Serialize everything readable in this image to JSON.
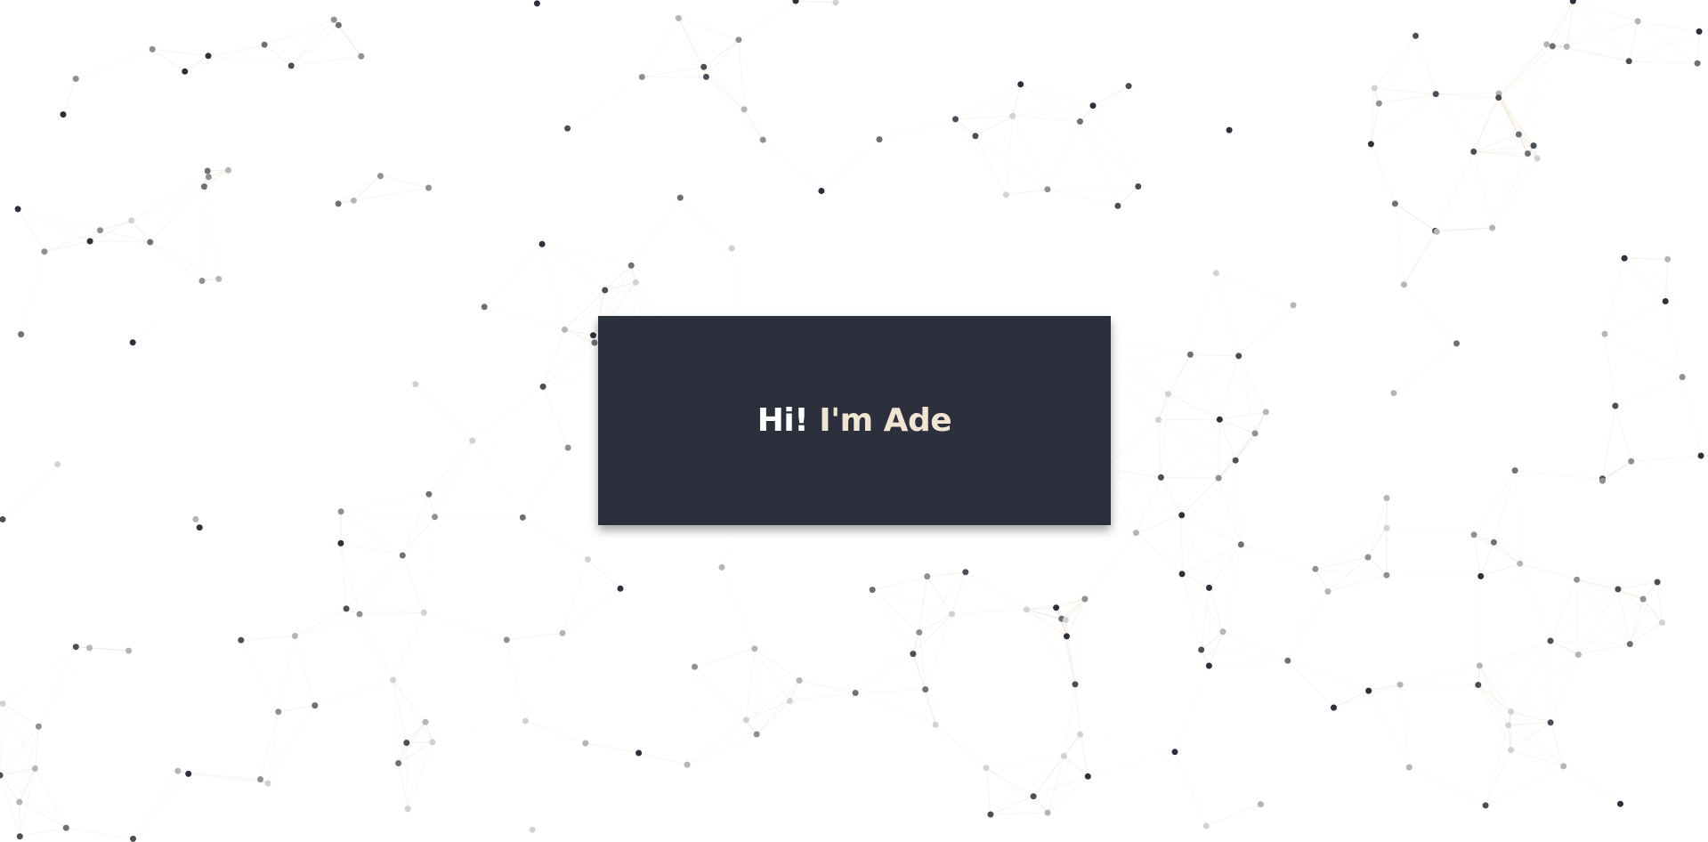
{
  "hero": {
    "greeting": "Hi!",
    "name": "I'm Ade"
  },
  "colors": {
    "background": "#ffffff",
    "card": "#2b303c",
    "greeting_text": "#ffffff",
    "name_text": "#f2e4d3",
    "node_shades": [
      "#2b303c",
      "#4a4e57",
      "#6e7076",
      "#8f9094",
      "#b5b5b8",
      "#d2d2d4"
    ],
    "link_color": "#e9d6c0"
  },
  "background_effect": "particle-network"
}
